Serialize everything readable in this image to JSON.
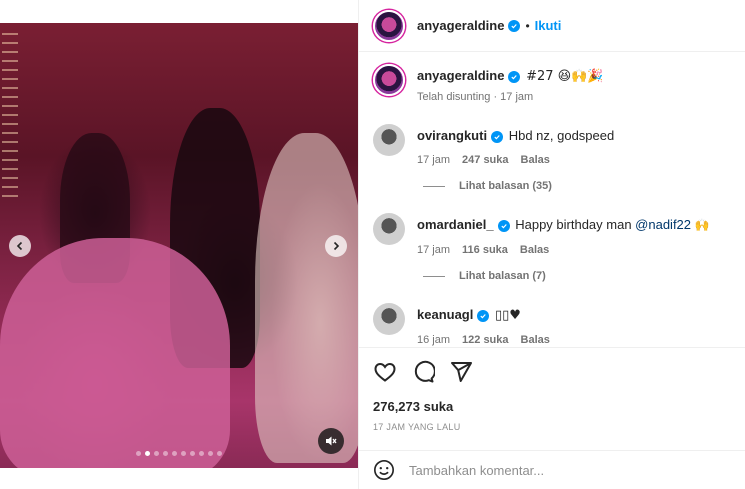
{
  "header": {
    "username": "anyageraldine",
    "separator": "•",
    "follow_label": "Ikuti"
  },
  "caption": {
    "username": "anyageraldine",
    "text": "#27 😆🙌🎉",
    "edited": "Telah disunting · 17 jam"
  },
  "comments": [
    {
      "username": "ovirangkuti",
      "text": "Hbd nz, godspeed",
      "time": "17 jam",
      "likes": "247 suka",
      "reply": "Balas",
      "view_replies": "Lihat balasan (35)"
    },
    {
      "username": "omardaniel_",
      "text": "Happy birthday man ",
      "mention": "@nadif22",
      "emoji": "🙌",
      "time": "17 jam",
      "likes": "116 suka",
      "reply": "Balas",
      "view_replies": "Lihat balasan (7)"
    },
    {
      "username": "keanuagl",
      "text": "▯▯♥",
      "time": "16 jam",
      "likes": "122 suka",
      "reply": "Balas"
    }
  ],
  "post": {
    "likes": "276,273 suka",
    "posted": "17 JAM YANG LALU"
  },
  "add_comment": {
    "placeholder": "Tambahkan komentar..."
  },
  "carousel": {
    "slide_count": 10,
    "active_index": 1
  },
  "icons": [
    "heart-icon",
    "comment-icon",
    "share-icon",
    "chevron-left-icon",
    "chevron-right-icon",
    "mute-icon",
    "smiley-icon",
    "verified-icon"
  ],
  "colors": {
    "accent": "#0095f6",
    "mention": "#00376b",
    "muted": "#737373"
  }
}
